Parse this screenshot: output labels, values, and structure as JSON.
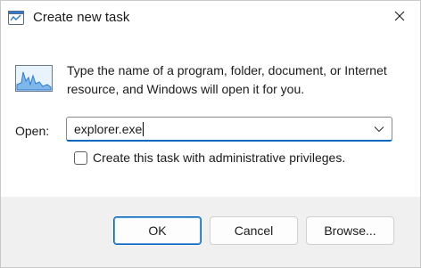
{
  "window": {
    "title": "Create new task",
    "title_icon": "run-dialog-icon",
    "close_icon": "close-icon"
  },
  "body": {
    "icon": "performance-graph-icon",
    "description": "Type the name of a program, folder, document, or Internet resource, and Windows will open it for you.",
    "open_label": "Open:",
    "open_value": "explorer.exe",
    "dropdown_icon": "chevron-down-icon",
    "admin_checkbox_label": "Create this task with administrative privileges.",
    "admin_checkbox_checked": false
  },
  "buttons": {
    "ok": "OK",
    "cancel": "Cancel",
    "browse": "Browse..."
  },
  "colors": {
    "accent": "#0067c0",
    "footer_bg": "#f0f0f0"
  }
}
